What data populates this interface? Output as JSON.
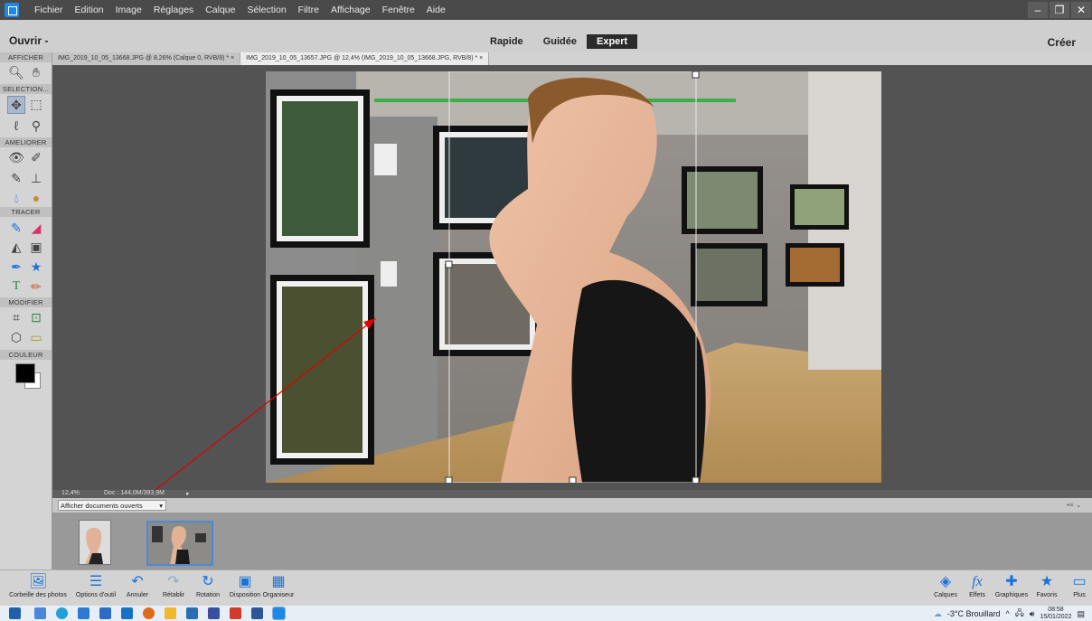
{
  "menubar": {
    "items": [
      "Fichier",
      "Edition",
      "Image",
      "Réglages",
      "Calque",
      "Sélection",
      "Filtre",
      "Affichage",
      "Fenêtre",
      "Aide"
    ]
  },
  "modebar": {
    "open_label": "Ouvrir",
    "modes": [
      "Rapide",
      "Guidée",
      "Expert"
    ],
    "active_mode": "Expert",
    "create_label": "Créer"
  },
  "toolbox": {
    "sections": [
      "AFFICHER",
      "SELECTION...",
      "AMELIORER",
      "TRACER",
      "MODIFIER",
      "COULEUR"
    ]
  },
  "tabs": [
    {
      "label": "IMG_2019_10_05_13668.JPG @ 8,26% (Calque 0, RVB/8) *",
      "close": "×"
    },
    {
      "label": "IMG_2019_10_05_13657.JPG @ 12,4% (IMG_2019_10_05_13668.JPG, RVB/8) *",
      "close": "×"
    }
  ],
  "status": {
    "zoom": "12,4%",
    "doc": "Doc : 144,0M/393,9M"
  },
  "bin": {
    "dropdown": "Afficher documents ouverts"
  },
  "bottombar": {
    "left": [
      "Corbeille des photos",
      "Options d'outil",
      "Annuler",
      "Rétablir",
      "Rotation",
      "Disposition",
      "Organiseur"
    ],
    "right": [
      "Calques",
      "Effets",
      "Graphiques",
      "Favoris",
      "Plus"
    ]
  },
  "tray": {
    "weather": "-3°C  Brouillard",
    "time": "08:58",
    "date": "15/01/2022"
  },
  "colors": {
    "accent": "#1a73d9",
    "annotation": "#e00000"
  }
}
